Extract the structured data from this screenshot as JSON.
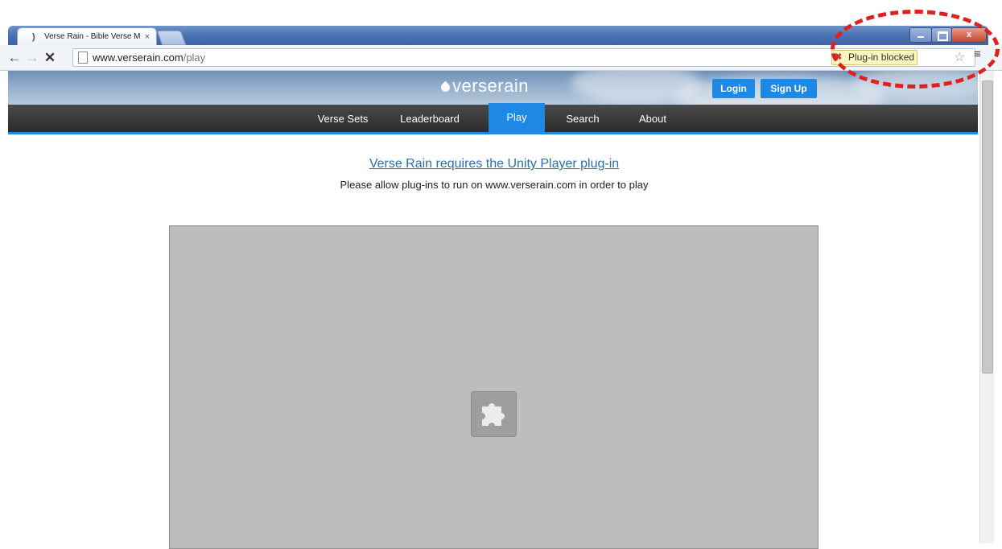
{
  "browser": {
    "tab_title": "Verse Rain - Bible Verse M",
    "tab_favicon": ")",
    "tab_close": "×",
    "win_close": "x",
    "url_host": "www.verserain.com",
    "url_path": "/play",
    "plugin_blocked_label": "Plug-in blocked",
    "back_icon": "←",
    "forward_icon": "→",
    "stop_icon": "✕",
    "star_icon": "☆",
    "menu_icon": "≡",
    "plugin_blocked_icon": "✖"
  },
  "site": {
    "logo_text_a": "verse",
    "logo_text_b": "rain",
    "login_label": "Login",
    "signup_label": "Sign Up",
    "nav": [
      {
        "label": "Verse Sets"
      },
      {
        "label": "Leaderboard"
      },
      {
        "label": "Play",
        "active": true
      },
      {
        "label": "Search"
      },
      {
        "label": "About"
      }
    ],
    "accent_color": "#1e88e5"
  },
  "main": {
    "requirement_link": "Verse Rain requires the Unity Player plug-in",
    "requirement_sub": "Please allow plug-ins to run on www.verserain.com in order to play",
    "placeholder_icon": "puzzle-piece-icon"
  },
  "annotation": {
    "color": "#e0201a",
    "style": "dashed ellipse"
  }
}
